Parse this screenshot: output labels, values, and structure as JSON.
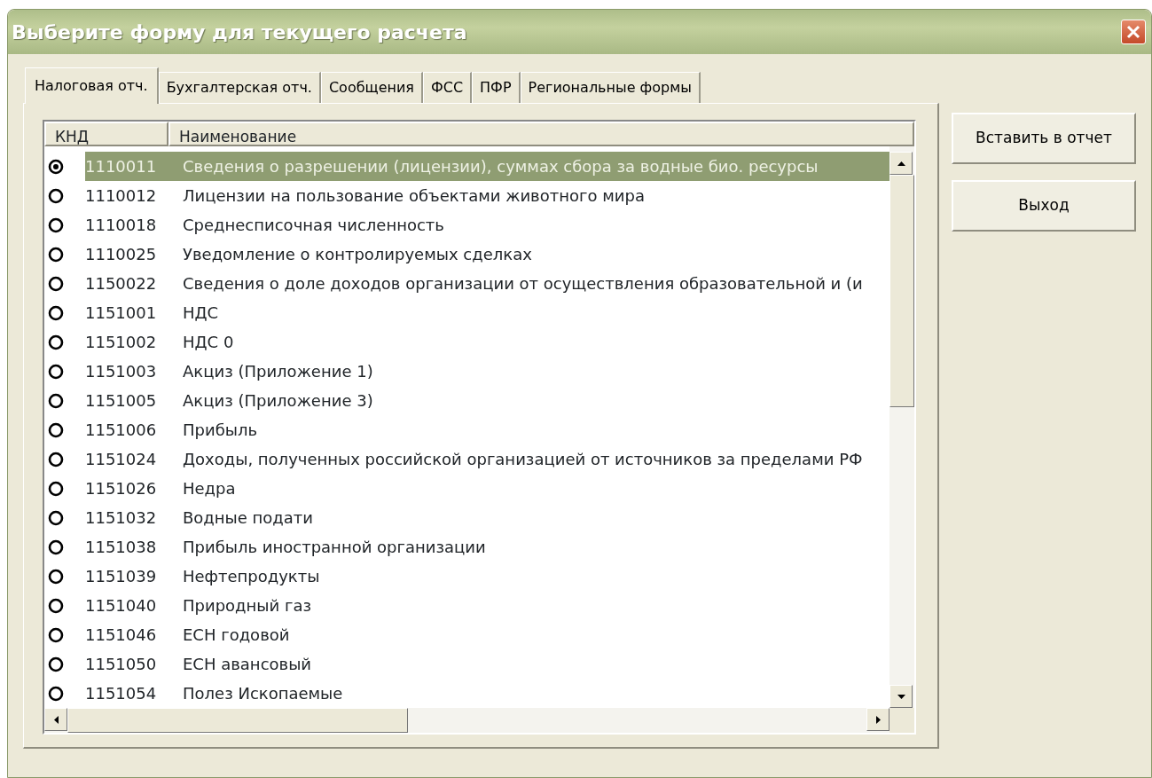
{
  "window": {
    "title": "Выберите форму для текущего расчета"
  },
  "tabs": [
    {
      "label": "Налоговая отч.",
      "selected": true
    },
    {
      "label": "Бухгалтерская отч.",
      "selected": false
    },
    {
      "label": "Сообщения",
      "selected": false
    },
    {
      "label": "ФСС",
      "selected": false
    },
    {
      "label": "ПФР",
      "selected": false
    },
    {
      "label": "Региональные формы",
      "selected": false
    }
  ],
  "table": {
    "columns": [
      "КНД",
      "Наименование"
    ],
    "rows": [
      {
        "code": "1110011",
        "name": "Сведения о разрешении (лицензии), суммах сбора за водные био. ресурсы",
        "selected": true
      },
      {
        "code": "1110012",
        "name": "Лицензии на пользование объектами животного мира",
        "selected": false
      },
      {
        "code": "1110018",
        "name": "Среднесписочная численность",
        "selected": false
      },
      {
        "code": "1110025",
        "name": "Уведомление о контролируемых сделках",
        "selected": false
      },
      {
        "code": "1150022",
        "name": "Сведения о доле доходов организации от осуществления образовательной и (и",
        "selected": false
      },
      {
        "code": "1151001",
        "name": "НДС",
        "selected": false
      },
      {
        "code": "1151002",
        "name": "НДС 0",
        "selected": false
      },
      {
        "code": "1151003",
        "name": "Акциз (Приложение 1)",
        "selected": false
      },
      {
        "code": "1151005",
        "name": "Акциз (Приложение 3)",
        "selected": false
      },
      {
        "code": "1151006",
        "name": "Прибыль",
        "selected": false
      },
      {
        "code": "1151024",
        "name": "Доходы, полученных российской организацией от источников за пределами РФ",
        "selected": false
      },
      {
        "code": "1151026",
        "name": "Недра",
        "selected": false
      },
      {
        "code": "1151032",
        "name": "Водные подати",
        "selected": false
      },
      {
        "code": "1151038",
        "name": "Прибыль иностранной организации",
        "selected": false
      },
      {
        "code": "1151039",
        "name": "Нефтепродукты",
        "selected": false
      },
      {
        "code": "1151040",
        "name": "Природный газ",
        "selected": false
      },
      {
        "code": "1151046",
        "name": "ЕСН годовой",
        "selected": false
      },
      {
        "code": "1151050",
        "name": "ЕСН авансовый",
        "selected": false
      },
      {
        "code": "1151054",
        "name": "Полез Ископаемые",
        "selected": false
      }
    ]
  },
  "buttons": [
    "Вставить в отчет",
    "Выход"
  ]
}
